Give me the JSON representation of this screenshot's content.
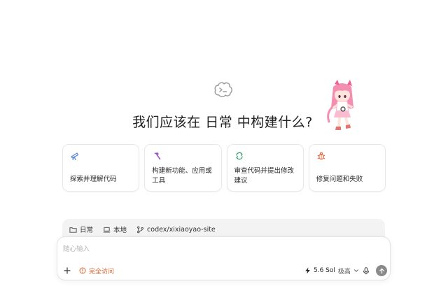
{
  "hero": {
    "logo_icon": "codex-cloud-icon",
    "title": "我们应该在 日常 中构建什么?"
  },
  "cards": [
    {
      "icon": "telescope-icon",
      "label": "探索并理解代码",
      "color": "#4a7fd6"
    },
    {
      "icon": "hammer-icon",
      "label": "构建新功能、应用或工具",
      "color": "#9b59c9"
    },
    {
      "icon": "review-icon",
      "label": "审查代码并提出修改建议",
      "color": "#2f9d6b"
    },
    {
      "icon": "bug-icon",
      "label": "修复问题和失败",
      "color": "#e0653a"
    }
  ],
  "context": {
    "folder": "日常",
    "environment": "本地",
    "repo": "codex/xixiaoyao-site"
  },
  "composer": {
    "placeholder": "随心输入",
    "access_label": "完全访问",
    "model": "5.6 Sol",
    "effort": "极高"
  }
}
